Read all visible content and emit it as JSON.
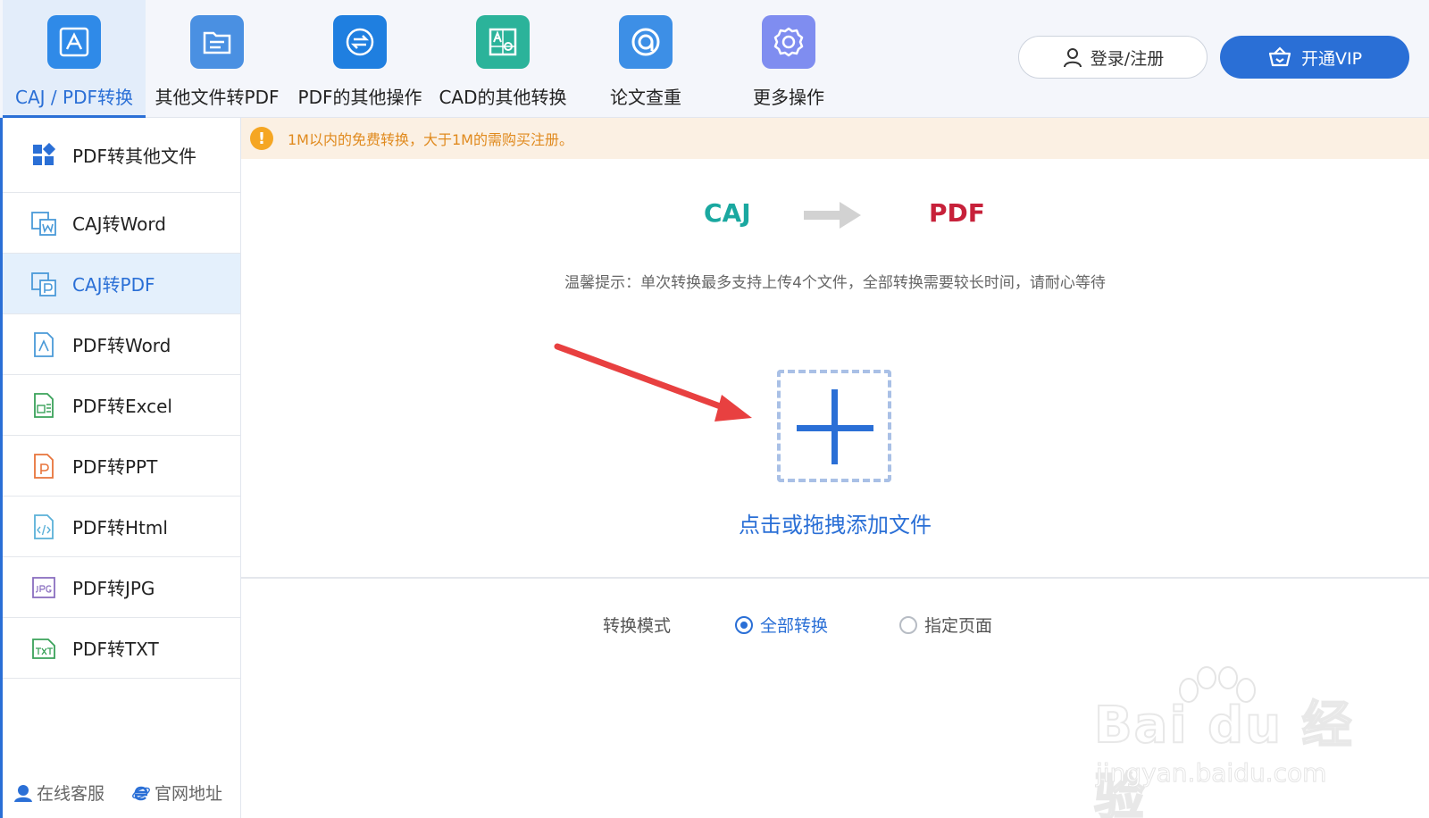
{
  "toolbar": {
    "tools": [
      {
        "label": "CAJ / PDF转换",
        "icon": "pdf-convert-icon",
        "color": "#2f8ae8",
        "active": true
      },
      {
        "label": "其他文件转PDF",
        "icon": "file-to-pdf-icon",
        "color": "#4a90e2"
      },
      {
        "label": "PDF的其他操作",
        "icon": "pdf-swap-icon",
        "color": "#1f7fe0"
      },
      {
        "label": "CAD的其他转换",
        "icon": "cad-icon",
        "color": "#2bb39a"
      },
      {
        "label": "论文查重",
        "icon": "paper-check-icon",
        "color": "#3d8fe6"
      },
      {
        "label": "更多操作",
        "icon": "gear-icon",
        "color": "#7f8df0"
      }
    ],
    "login_label": "登录/注册",
    "vip_label": "开通VIP"
  },
  "sidebar": {
    "items": [
      {
        "label": "PDF转其他文件",
        "icon": "grid-icon"
      },
      {
        "label": "CAJ转Word",
        "icon": "caj-word-icon"
      },
      {
        "label": "CAJ转PDF",
        "icon": "caj-pdf-icon",
        "active": true
      },
      {
        "label": "PDF转Word",
        "icon": "pdf-word-icon"
      },
      {
        "label": "PDF转Excel",
        "icon": "pdf-excel-icon"
      },
      {
        "label": "PDF转PPT",
        "icon": "pdf-ppt-icon"
      },
      {
        "label": "PDF转Html",
        "icon": "pdf-html-icon"
      },
      {
        "label": "PDF转JPG",
        "icon": "pdf-jpg-icon"
      },
      {
        "label": "PDF转TXT",
        "icon": "pdf-txt-icon"
      }
    ],
    "footer": {
      "service_label": "在线客服",
      "website_label": "官网地址"
    }
  },
  "main": {
    "notice": "1M以内的免费转换，大于1M的需购买注册。",
    "from_format": "CAJ",
    "to_format": "PDF",
    "tip": "温馨提示：单次转换最多支持上传4个文件，全部转换需要较长时间，请耐心等待",
    "drop_label": "点击或拖拽添加文件",
    "mode_label": "转换模式",
    "modes": [
      {
        "label": "全部转换",
        "checked": true
      },
      {
        "label": "指定页面",
        "checked": false
      }
    ]
  },
  "watermark": {
    "main": "Bai du 经验",
    "sub": "jingyan.baidu.com"
  },
  "colors": {
    "accent": "#2a6fd6",
    "caj": "#1aa8a0",
    "pdf": "#c7213a",
    "notice": "#e08a1e"
  }
}
